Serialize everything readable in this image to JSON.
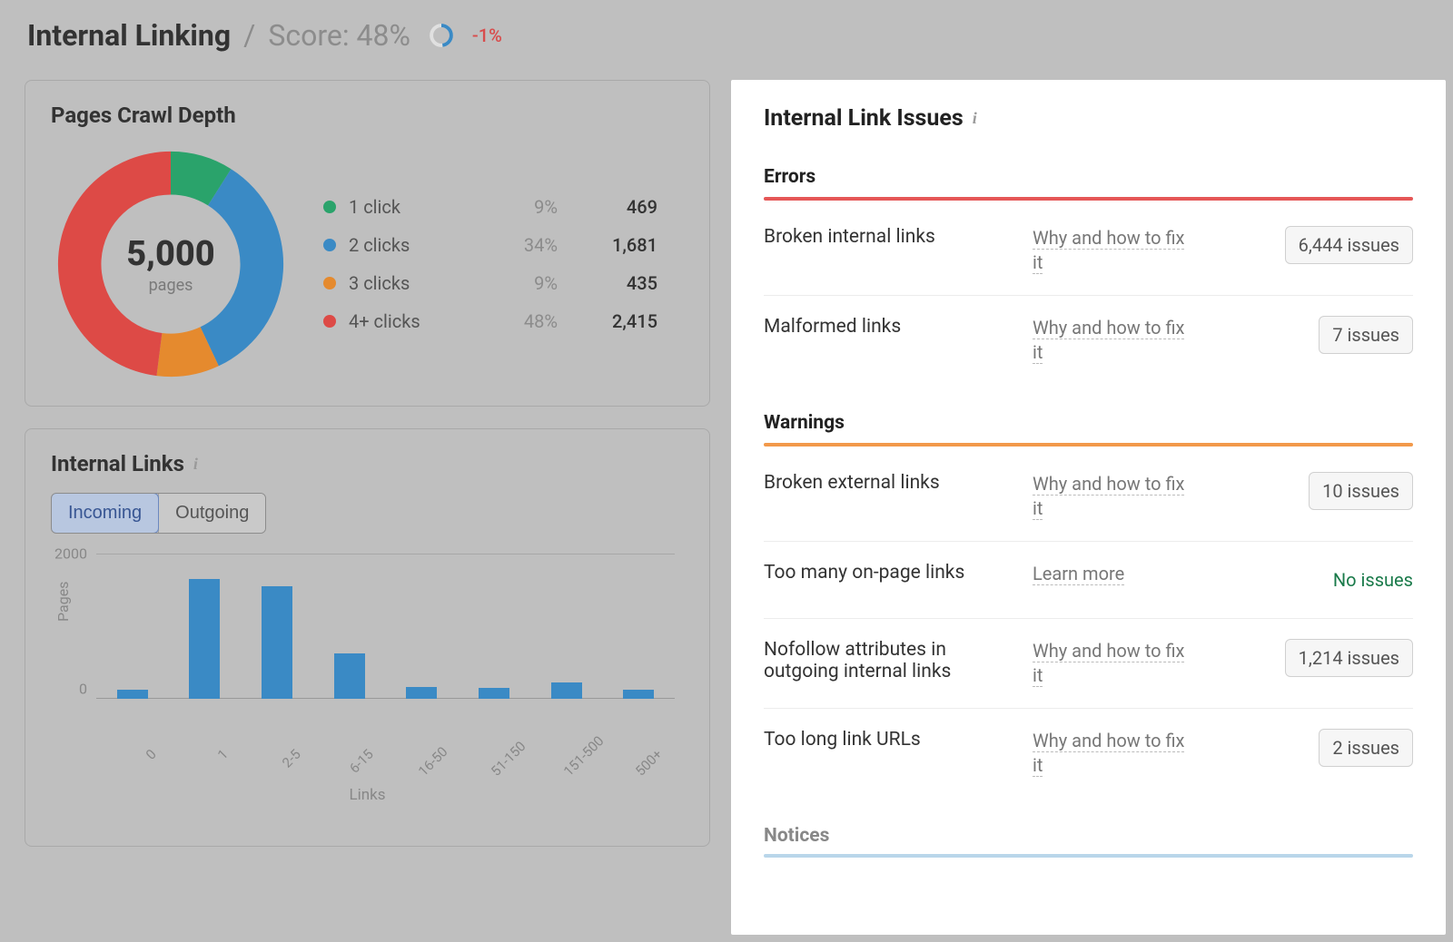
{
  "header": {
    "title": "Internal Linking",
    "separator": "/",
    "score_label": "Score: 48%",
    "delta": "-1%"
  },
  "crawl_depth_card": {
    "title": "Pages Crawl Depth",
    "total": "5,000",
    "total_unit": "pages",
    "legend": [
      {
        "label": "1 click",
        "pct": "9%",
        "count": "469",
        "color": "#2aa36b"
      },
      {
        "label": "2 clicks",
        "pct": "34%",
        "count": "1,681",
        "color": "#3a8ac5"
      },
      {
        "label": "3 clicks",
        "pct": "9%",
        "count": "435",
        "color": "#e58a2e"
      },
      {
        "label": "4+ clicks",
        "pct": "48%",
        "count": "2,415",
        "color": "#dd4a46"
      }
    ]
  },
  "internal_links_card": {
    "title": "Internal Links",
    "tabs": [
      "Incoming",
      "Outgoing"
    ],
    "active_tab": 0,
    "yticks": [
      "2000",
      "0"
    ],
    "ylabel": "Pages",
    "xlabel": "Links"
  },
  "chart_data": [
    {
      "type": "pie",
      "title": "Pages Crawl Depth",
      "categories": [
        "1 click",
        "2 clicks",
        "3 clicks",
        "4+ clicks"
      ],
      "values": [
        469,
        1681,
        435,
        2415
      ],
      "percentages": [
        9,
        34,
        9,
        48
      ],
      "colors": [
        "#2aa36b",
        "#3a8ac5",
        "#e58a2e",
        "#dd4a46"
      ],
      "total": 5000
    },
    {
      "type": "bar",
      "title": "Internal Links (Incoming)",
      "categories": [
        "0",
        "1",
        "2-5",
        "6-15",
        "16-50",
        "51-150",
        "151-500",
        "500+"
      ],
      "values": [
        120,
        1650,
        1550,
        620,
        160,
        150,
        230,
        130
      ],
      "xlabel": "Links",
      "ylabel": "Pages",
      "ylim": [
        0,
        2000
      ]
    }
  ],
  "issues_panel": {
    "title": "Internal Link Issues",
    "sections": [
      {
        "name": "Errors",
        "color": "error",
        "rows": [
          {
            "name": "Broken internal links",
            "link": "Why and how to fix it",
            "count": "6,444 issues"
          },
          {
            "name": "Malformed links",
            "link": "Why and how to fix it",
            "count": "7 issues"
          }
        ]
      },
      {
        "name": "Warnings",
        "color": "warn",
        "rows": [
          {
            "name": "Broken external links",
            "link": "Why and how to fix it",
            "count": "10 issues"
          },
          {
            "name": "Too many on-page links",
            "link": "Learn more",
            "no_issues": "No issues"
          },
          {
            "name": "Nofollow attributes in outgoing internal links",
            "link": "Why and how to fix it",
            "count": "1,214 issues"
          },
          {
            "name": "Too long link URLs",
            "link": "Why and how to fix it",
            "count": "2 issues"
          }
        ]
      },
      {
        "name": "Notices",
        "color": "notice",
        "rows": []
      }
    ]
  }
}
